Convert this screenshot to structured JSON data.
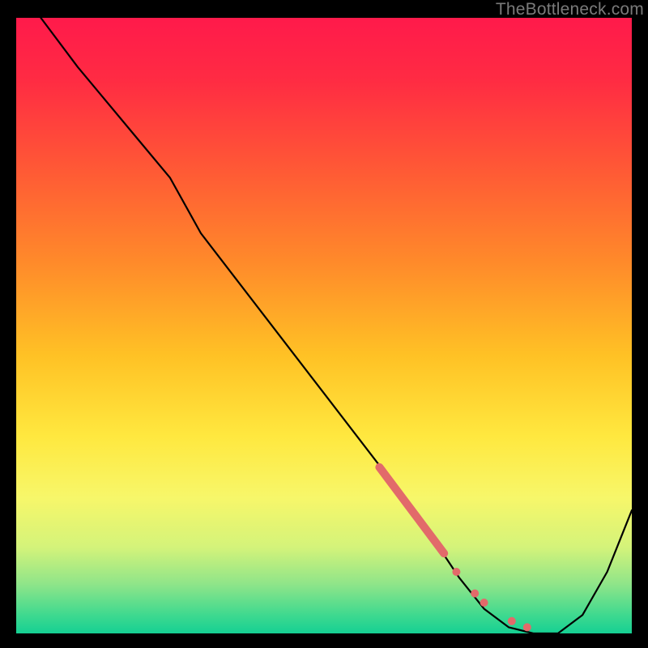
{
  "watermark": "TheBottleneck.com",
  "chart_data": {
    "type": "line",
    "title": "",
    "xlabel": "",
    "ylabel": "",
    "xlim": [
      0,
      100
    ],
    "ylim": [
      0,
      100
    ],
    "series": [
      {
        "name": "curve",
        "x": [
          4,
          10,
          20,
          25,
          30,
          40,
          50,
          60,
          68,
          72,
          76,
          80,
          84,
          88,
          92,
          96,
          100
        ],
        "y": [
          100,
          92,
          80,
          74,
          65,
          52,
          39,
          26,
          15,
          9,
          4,
          1,
          0,
          0,
          3,
          10,
          20
        ]
      }
    ],
    "highlight_segment": {
      "x": [
        59,
        69.5
      ],
      "y": [
        27,
        13
      ]
    },
    "highlight_dots": [
      {
        "x": 71.5,
        "y": 10
      },
      {
        "x": 74.5,
        "y": 6.5
      },
      {
        "x": 76,
        "y": 5
      },
      {
        "x": 80.5,
        "y": 2
      },
      {
        "x": 83,
        "y": 1
      }
    ],
    "gradient_stops": [
      {
        "offset": 0.0,
        "color": "#ff1a4b"
      },
      {
        "offset": 0.1,
        "color": "#ff2b43"
      },
      {
        "offset": 0.25,
        "color": "#ff5a35"
      },
      {
        "offset": 0.4,
        "color": "#ff8b2a"
      },
      {
        "offset": 0.55,
        "color": "#ffc225"
      },
      {
        "offset": 0.68,
        "color": "#ffe83f"
      },
      {
        "offset": 0.78,
        "color": "#f7f76a"
      },
      {
        "offset": 0.86,
        "color": "#d4f37a"
      },
      {
        "offset": 0.92,
        "color": "#8fe589"
      },
      {
        "offset": 0.97,
        "color": "#3fd98f"
      },
      {
        "offset": 1.0,
        "color": "#15d093"
      }
    ],
    "curve_color": "#000000",
    "highlight_color": "#e26a6a"
  }
}
